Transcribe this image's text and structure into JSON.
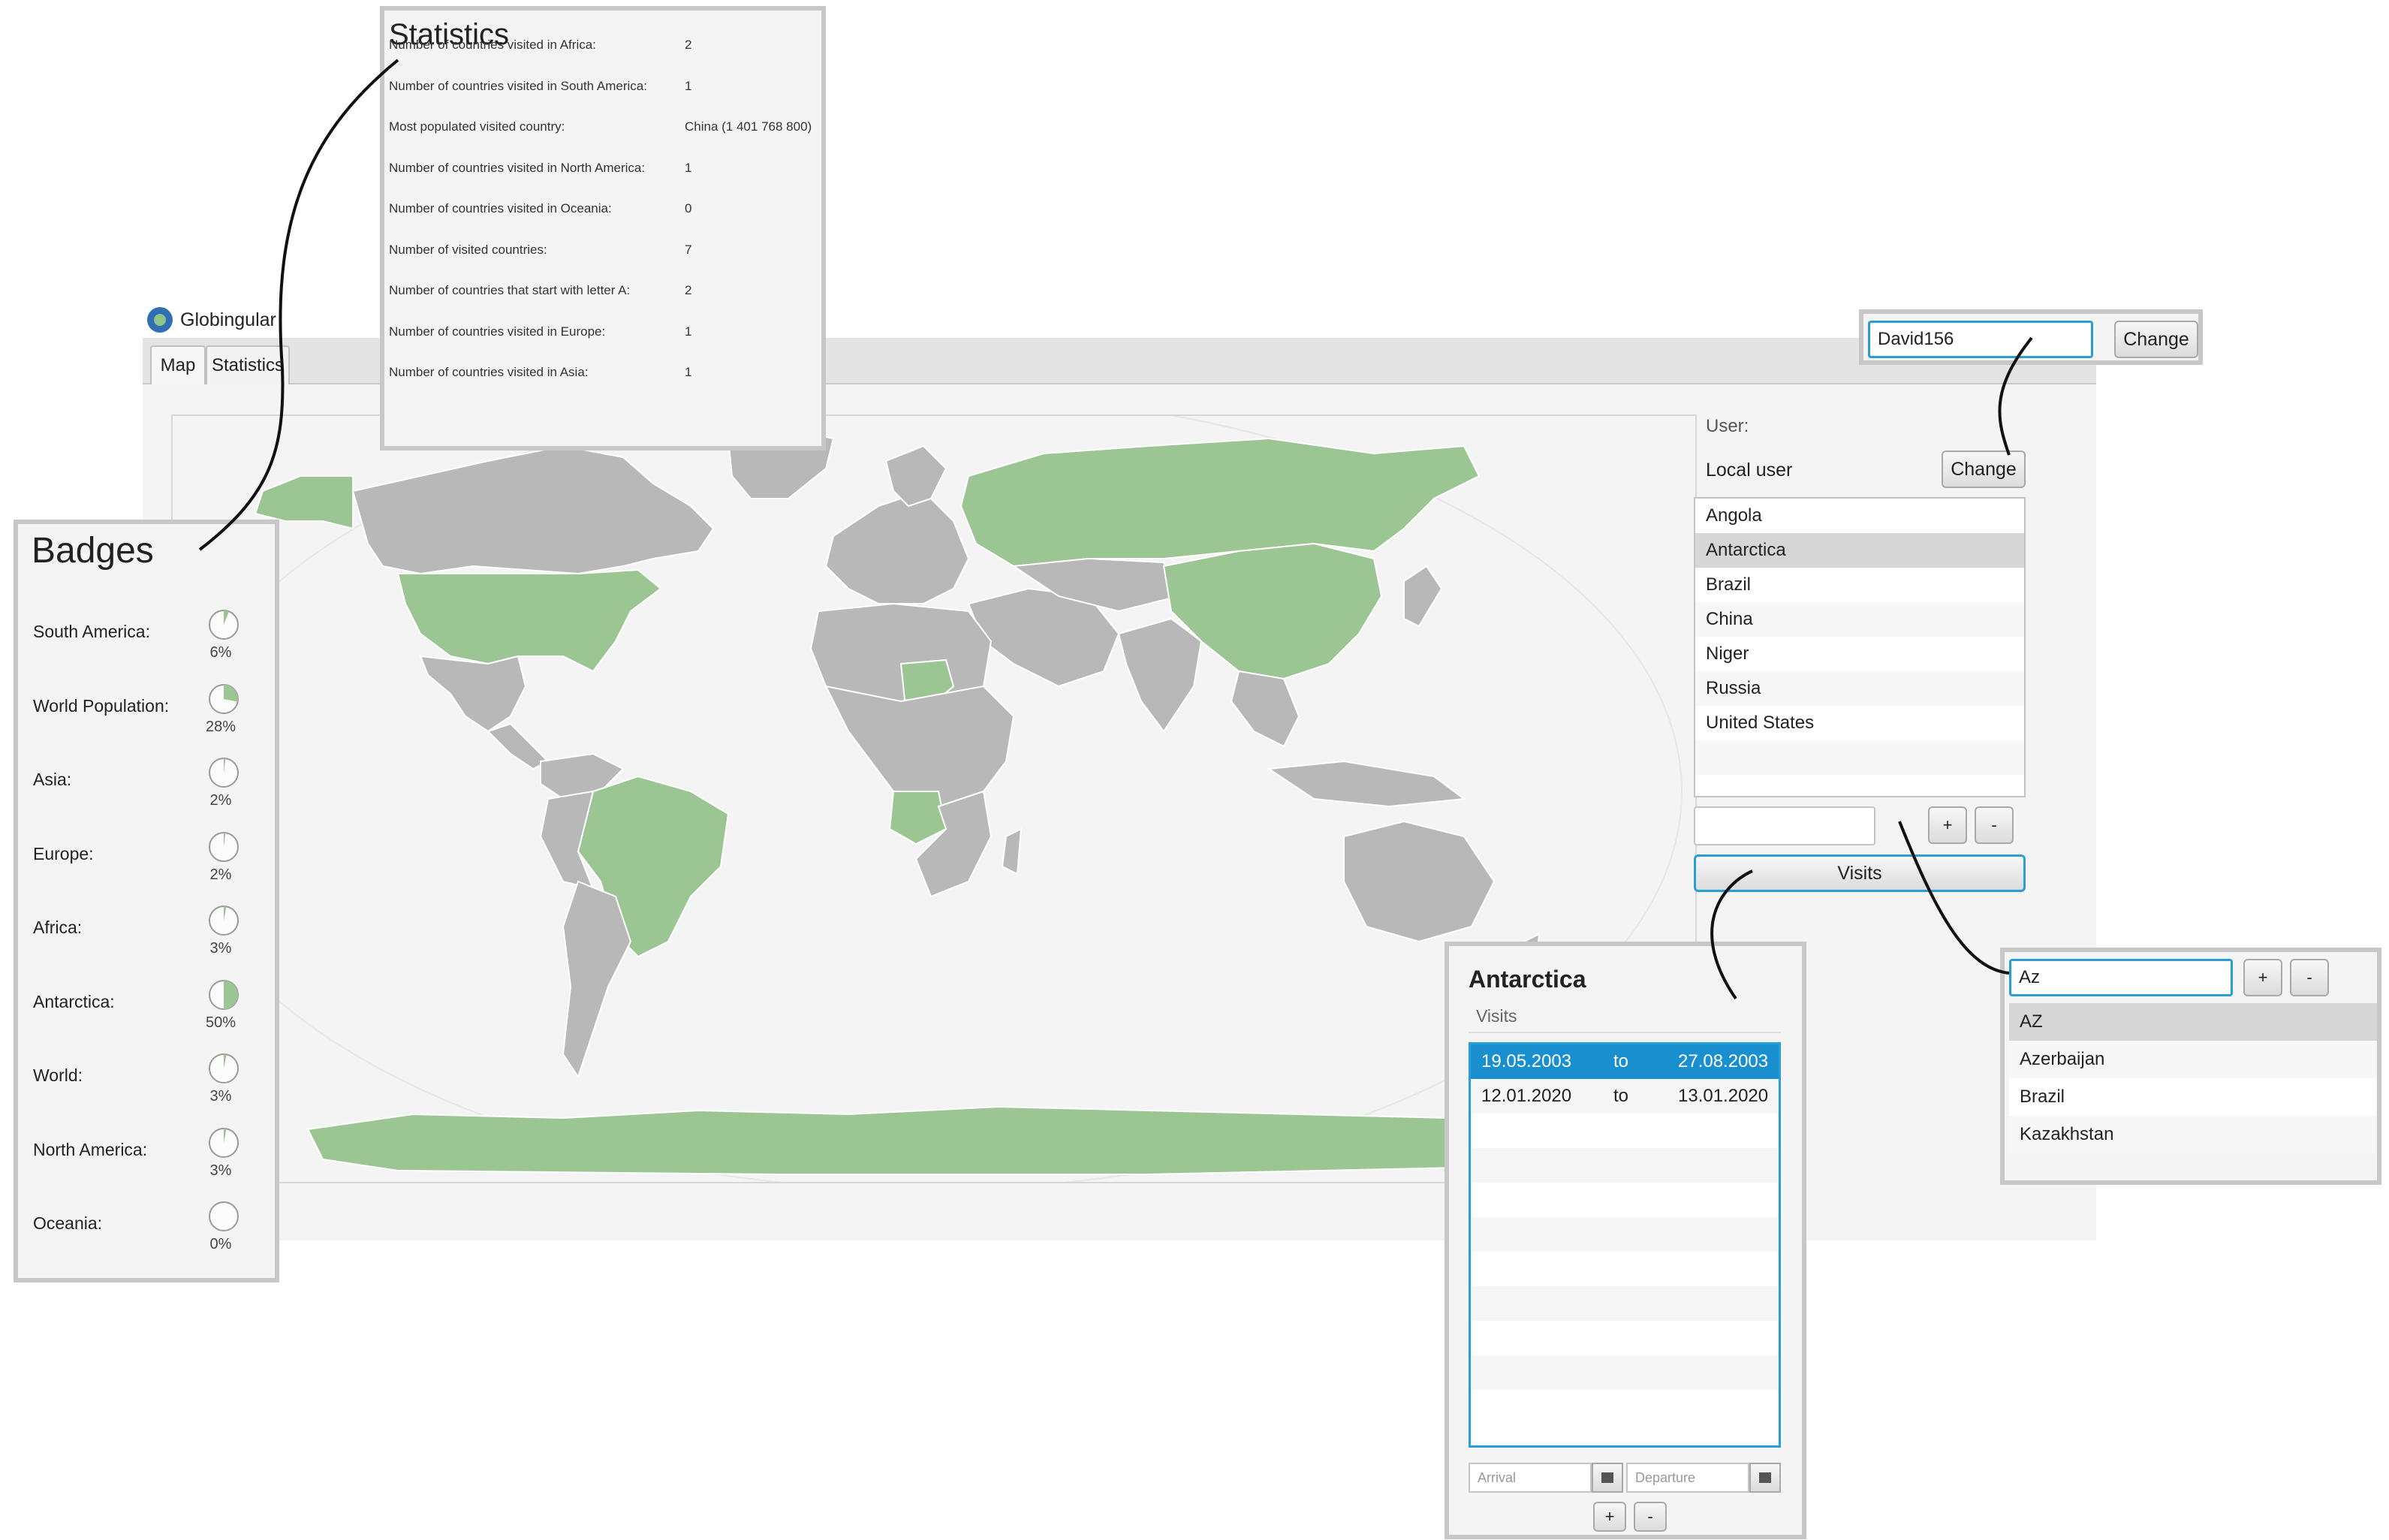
{
  "window": {
    "title": "Globingular",
    "tabs": [
      {
        "label": "Map"
      },
      {
        "label": "Statistics"
      }
    ]
  },
  "map": {
    "visited_color": "#9cc594",
    "unvisited_color": "#b8b8b8",
    "visited_countries": [
      "Angola",
      "Antarctica",
      "Brazil",
      "China",
      "Niger",
      "Russia",
      "United States"
    ]
  },
  "user_panel": {
    "user_label": "User:",
    "user_name": "Local user",
    "change_label": "Change",
    "countries": [
      "Angola",
      "Antarctica",
      "Brazil",
      "China",
      "Niger",
      "Russia",
      "United States"
    ],
    "selected_country": "Antarctica",
    "add_label": "+",
    "remove_label": "-",
    "visits_label": "Visits",
    "accent_color": "#2a9fd6"
  },
  "username_callout": {
    "value": "David156",
    "change_label": "Change"
  },
  "statistics": {
    "title": "Statistics",
    "rows": [
      {
        "label": "Number of countries visited in Africa:",
        "value": "2"
      },
      {
        "label": "Number of countries visited in South America:",
        "value": "1"
      },
      {
        "label": "Most populated visited country:",
        "value": "China (1 401 768 800)"
      },
      {
        "label": "Number of countries visited in North America:",
        "value": "1"
      },
      {
        "label": "Number of countries visited in Oceania:",
        "value": "0"
      },
      {
        "label": "Number of visited countries:",
        "value": "7"
      },
      {
        "label": "Number of countries that start with letter A:",
        "value": "2"
      },
      {
        "label": "Number of countries visited in Europe:",
        "value": "1"
      },
      {
        "label": "Number of countries visited in Asia:",
        "value": "1"
      }
    ]
  },
  "badges": {
    "title": "Badges",
    "items": [
      {
        "label": "South America:",
        "percent": 6,
        "percent_text": "6%"
      },
      {
        "label": "World Population:",
        "percent": 28,
        "percent_text": "28%"
      },
      {
        "label": "Asia:",
        "percent": 2,
        "percent_text": "2%"
      },
      {
        "label": "Europe:",
        "percent": 2,
        "percent_text": "2%"
      },
      {
        "label": "Africa:",
        "percent": 3,
        "percent_text": "3%"
      },
      {
        "label": "Antarctica:",
        "percent": 50,
        "percent_text": "50%"
      },
      {
        "label": "World:",
        "percent": 3,
        "percent_text": "3%"
      },
      {
        "label": "North America:",
        "percent": 3,
        "percent_text": "3%"
      },
      {
        "label": "Oceania:",
        "percent": 0,
        "percent_text": "0%"
      }
    ]
  },
  "visits_panel": {
    "country": "Antarctica",
    "subtitle": "Visits",
    "visits": [
      {
        "arrival": "19.05.2003",
        "sep": "to",
        "departure": "27.08.2003",
        "selected": true
      },
      {
        "arrival": "12.01.2020",
        "sep": "to",
        "departure": "13.01.2020",
        "selected": false
      }
    ],
    "arrival_placeholder": "Arrival",
    "departure_placeholder": "Departure",
    "add_label": "+",
    "remove_label": "-",
    "selection_color": "#1a8fd0"
  },
  "autocomplete": {
    "input_value": "Az",
    "add_label": "+",
    "remove_label": "-",
    "options": [
      "AZ",
      "Azerbaijan",
      "Brazil",
      "Kazakhstan"
    ],
    "highlighted": "AZ"
  }
}
